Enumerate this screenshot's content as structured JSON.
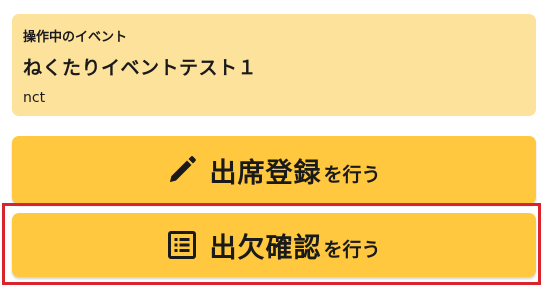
{
  "event": {
    "caption": "操作中のイベント",
    "name": "ねくたりイベントテスト１",
    "code": "nct"
  },
  "actions": {
    "attendance": {
      "main_label": "出席登録",
      "suffix_label": "を行う",
      "icon": "pencil-icon"
    },
    "check": {
      "main_label": "出欠確認",
      "suffix_label": "を行う",
      "icon": "list-icon"
    }
  },
  "colors": {
    "card_bg": "#fde29b",
    "button_bg": "#ffc83f",
    "highlight": "#d9232d",
    "text": "#1a1a1a"
  }
}
